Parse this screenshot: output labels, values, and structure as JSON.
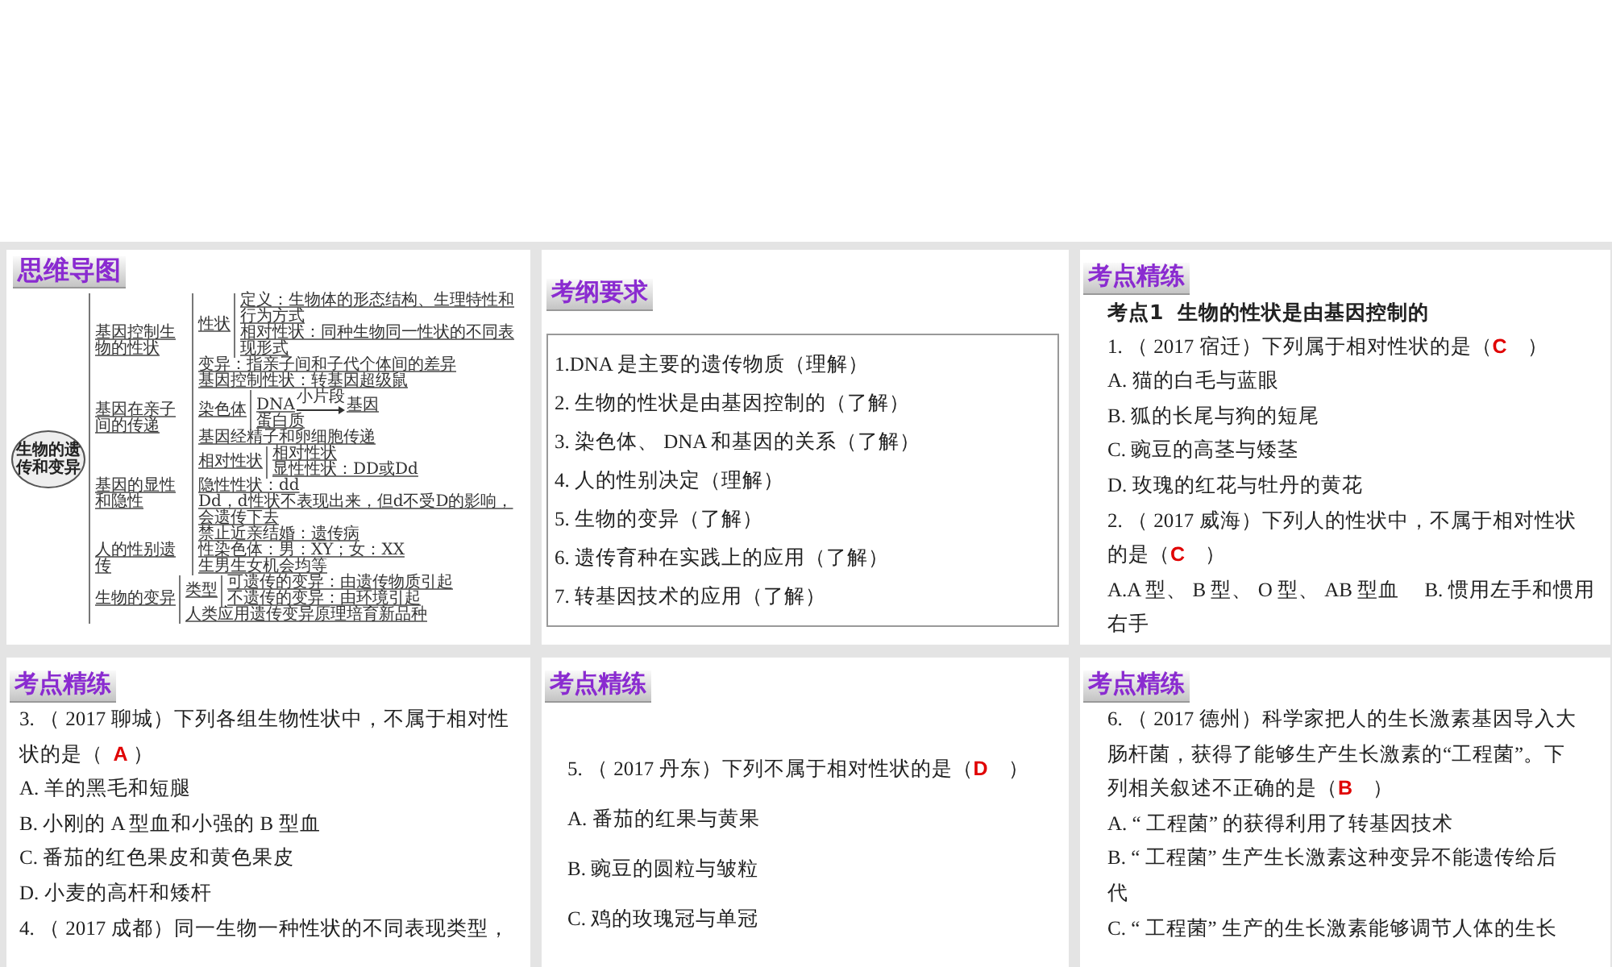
{
  "slides": [
    {
      "kind": "mindmap",
      "title": "思维导图",
      "root": "生物的遗传和变异",
      "children": [
        {
          "label": "基因控制生物的性状",
          "children": [
            {
              "label": "性状",
              "children": [
                {
                  "label": "定义：生物体的形态结构、生理特性和行为方式"
                },
                {
                  "label": "相对性状：同种生物同一性状的不同表现形式"
                }
              ]
            },
            {
              "label": "变异：指亲子间和子代个体间的差异"
            },
            {
              "label": "基因控制性状：转基因超级鼠"
            }
          ]
        },
        {
          "label": "基因在亲子间的传递",
          "children": [
            {
              "label": "染色体",
              "children": [
                {
                  "kind": "arrow",
                  "from": "DNA",
                  "over": "小片段",
                  "to": "基因"
                },
                {
                  "label": "蛋白质"
                }
              ]
            },
            {
              "label": "基因经精子和卵细胞传递"
            }
          ]
        },
        {
          "label": "基因的显性和隐性",
          "children": [
            {
              "label": "相对性状",
              "children": [
                {
                  "label": "相对性状"
                },
                {
                  "label": "显性性状：DD或Dd"
                }
              ]
            },
            {
              "label": "隐性性状：dd"
            },
            {
              "label": "Dd，d性状不表现出来，但d不受D的影响，会遗传下去"
            },
            {
              "label": "禁止近亲结婚：遗传病"
            }
          ]
        },
        {
          "label": "人的性别遗传",
          "children": [
            {
              "label": "性染色体：男：XY；女：XX"
            },
            {
              "label": "生男生女机会均等"
            }
          ]
        },
        {
          "label": "生物的变异",
          "children": [
            {
              "label": "类型",
              "children": [
                {
                  "label": "可遗传的变异：由遗传物质引起"
                },
                {
                  "label": "不遗传的变异：由环境引起"
                }
              ]
            },
            {
              "label": "人类应用遗传变异原理培育新品种"
            }
          ]
        }
      ]
    },
    {
      "kind": "outline",
      "title": "考纲要求",
      "items": [
        "1.DNA 是主要的遗传物质（理解）",
        "2. 生物的性状是由基因控制的（了解）",
        "3. 染色体、 DNA 和基因的关系（了解）",
        "4. 人的性别决定（理解）",
        "5. 生物的变异（了解）",
        "6. 遗传育种在实践上的应用（了解）",
        "7. 转基因技术的应用（了解）"
      ]
    },
    {
      "kind": "exercise",
      "title": "考点精练",
      "lines": [
        {
          "kind": "heading",
          "segments": [
            {
              "text": "考点1  生物的性状是由基因控制的",
              "answer": false
            }
          ]
        },
        {
          "kind": "question",
          "segments": [
            {
              "text": "1. （ 2017 宿迁）下列属于相对性状的是（",
              "answer": false
            },
            {
              "text": "C",
              "answer": true
            },
            {
              "text": "    ）",
              "answer": false
            }
          ]
        },
        {
          "kind": "option",
          "segments": [
            {
              "text": "A. 猫的白毛与蓝眼",
              "answer": false
            }
          ]
        },
        {
          "kind": "option",
          "segments": [
            {
              "text": "B. 狐的长尾与狗的短尾",
              "answer": false
            }
          ]
        },
        {
          "kind": "option",
          "segments": [
            {
              "text": "C. 豌豆的高茎与矮茎",
              "answer": false
            }
          ]
        },
        {
          "kind": "option",
          "segments": [
            {
              "text": "D. 玫瑰的红花与牡丹的黄花",
              "answer": false
            }
          ]
        },
        {
          "kind": "question",
          "segments": [
            {
              "text": "2. （ 2017 威海）下列人的性状中，不属于相对性状",
              "answer": false
            }
          ]
        },
        {
          "kind": "question",
          "segments": [
            {
              "text": "的是（",
              "answer": false
            },
            {
              "text": "C",
              "answer": true
            },
            {
              "text": "    ）",
              "answer": false
            }
          ]
        },
        {
          "kind": "option",
          "segments": [
            {
              "text": "A.A 型、 B 型、 O 型、 AB 型血     B. 惯用左手和惯用",
              "answer": false
            }
          ]
        },
        {
          "kind": "option",
          "segments": [
            {
              "text": "右手",
              "answer": false
            }
          ]
        }
      ]
    },
    {
      "kind": "exercise",
      "title": "考点精练",
      "lines": [
        {
          "kind": "question",
          "segments": [
            {
              "text": "3. （ 2017 聊城）下列各组生物性状中，不属于相对性",
              "answer": false
            }
          ]
        },
        {
          "kind": "question",
          "segments": [
            {
              "text": "状的是（  ",
              "answer": false
            },
            {
              "text": "A",
              "answer": true
            },
            {
              "text": " ）",
              "answer": false
            }
          ]
        },
        {
          "kind": "option",
          "segments": [
            {
              "text": "A. 羊的黑毛和短腿",
              "answer": false
            }
          ]
        },
        {
          "kind": "option",
          "segments": [
            {
              "text": "B. 小刚的 A 型血和小强的 B 型血",
              "answer": false
            }
          ]
        },
        {
          "kind": "option",
          "segments": [
            {
              "text": "C. 番茄的红色果皮和黄色果皮",
              "answer": false
            }
          ]
        },
        {
          "kind": "option",
          "segments": [
            {
              "text": "D. 小麦的高杆和矮杆",
              "answer": false
            }
          ]
        },
        {
          "kind": "question",
          "segments": [
            {
              "text": "4. （ 2017 成都）同一生物一种性状的不同表现类型，",
              "answer": false
            }
          ]
        }
      ]
    },
    {
      "kind": "exercise_wide",
      "title": "考点精练",
      "lines": [
        {
          "kind": "question",
          "segments": [
            {
              "text": "5. （ 2017 丹东）下列不属于相对性状的是（",
              "answer": false
            },
            {
              "text": "D",
              "answer": true
            },
            {
              "text": "    ）",
              "answer": false
            }
          ]
        },
        {
          "kind": "option",
          "segments": [
            {
              "text": "A. 番茄的红果与黄果",
              "answer": false
            }
          ]
        },
        {
          "kind": "option",
          "segments": [
            {
              "text": "B. 豌豆的圆粒与皱粒",
              "answer": false
            }
          ]
        },
        {
          "kind": "option",
          "segments": [
            {
              "text": "C. 鸡的玫瑰冠与单冠",
              "answer": false
            }
          ]
        }
      ]
    },
    {
      "kind": "exercise",
      "title": "考点精练",
      "lines": [
        {
          "kind": "question",
          "segments": [
            {
              "text": "6. （ 2017 德州）科学家把人的生长激素基因导入大",
              "answer": false
            }
          ]
        },
        {
          "kind": "question",
          "segments": [
            {
              "text": "肠杆菌，获得了能够生产生长激素的“工程菌”。下",
              "answer": false
            }
          ]
        },
        {
          "kind": "question",
          "segments": [
            {
              "text": "列相关叙述不正确的是（",
              "answer": false
            },
            {
              "text": "B",
              "answer": true
            },
            {
              "text": "    ）",
              "answer": false
            }
          ]
        },
        {
          "kind": "option",
          "segments": [
            {
              "text": "A. “ 工程菌” 的获得利用了转基因技术",
              "answer": false
            }
          ]
        },
        {
          "kind": "option",
          "segments": [
            {
              "text": "B. “ 工程菌” 生产生长激素这种变异不能遗传给后",
              "answer": false
            }
          ]
        },
        {
          "kind": "option",
          "segments": [
            {
              "text": "代",
              "answer": false
            }
          ]
        },
        {
          "kind": "option",
          "segments": [
            {
              "text": "C. “ 工程菌” 生产的生长激素能够调节人体的生长",
              "answer": false
            }
          ]
        }
      ]
    }
  ]
}
